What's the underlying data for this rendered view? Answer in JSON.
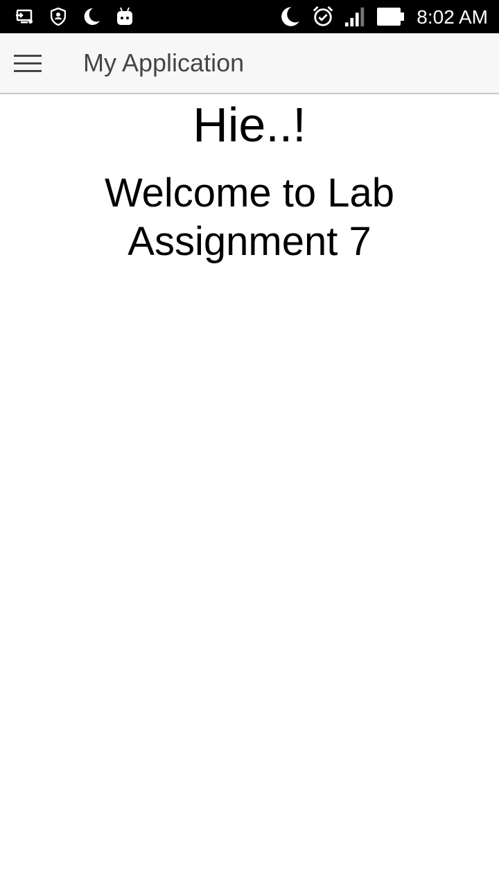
{
  "status_bar": {
    "time": "8:02 AM",
    "left_icons": [
      "screen-cast-icon",
      "shield-user-icon",
      "moon-icon",
      "android-icon"
    ],
    "right_icons": [
      "moon-icon",
      "alarm-icon",
      "signal-icon",
      "battery-icon"
    ]
  },
  "toolbar": {
    "title": "My Application",
    "menu_icon": "hamburger-menu-icon"
  },
  "main": {
    "greeting": "Hie..!",
    "welcome_text": "Welcome to Lab Assignment 7"
  },
  "colors": {
    "status_bar_bg": "#000000",
    "toolbar_bg": "#f7f7f7",
    "toolbar_text": "#454545",
    "content_text": "#000000"
  }
}
